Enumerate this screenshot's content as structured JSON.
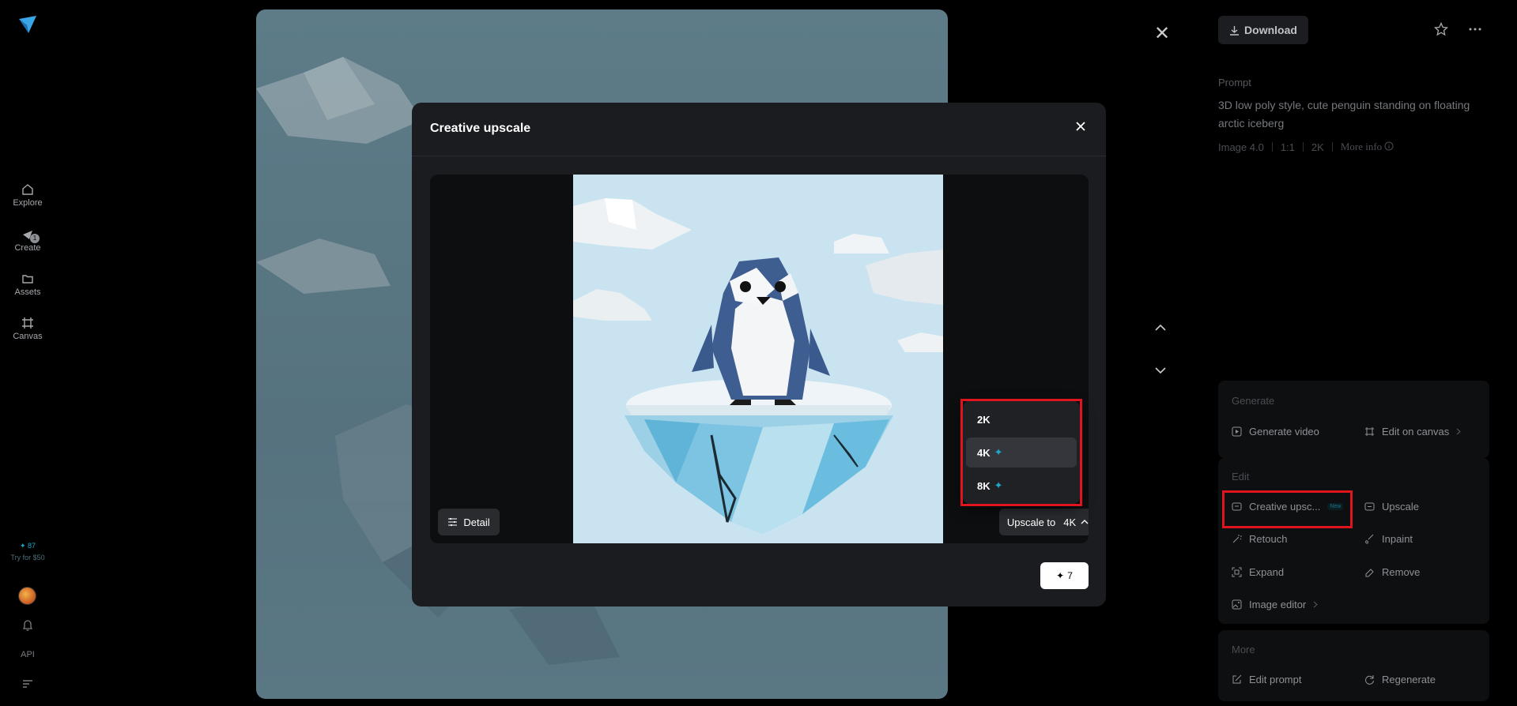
{
  "leftnav": {
    "items": [
      {
        "label": "Explore",
        "icon": "home-icon"
      },
      {
        "label": "Create",
        "icon": "create-icon",
        "badge": "1"
      },
      {
        "label": "Assets",
        "icon": "folder-icon"
      },
      {
        "label": "Canvas",
        "icon": "canvas-icon"
      }
    ],
    "credits": "✦ 87",
    "trial": "Try for $50",
    "api": "API"
  },
  "viewer": {
    "close_symbol": "✕"
  },
  "rpanel": {
    "download_label": "Download",
    "prompt_label": "Prompt",
    "prompt_text": "3D low poly style, cute penguin standing on floating arctic iceberg",
    "meta": {
      "model": "Image 4.0",
      "ratio": "1:1",
      "res": "2K",
      "more": "More info"
    },
    "generate": {
      "title": "Generate",
      "items": [
        {
          "label": "Generate video"
        },
        {
          "label": "Edit on canvas"
        }
      ]
    },
    "edit": {
      "title": "Edit",
      "items": [
        {
          "label": "Creative upsc...",
          "tag": "New"
        },
        {
          "label": "Upscale"
        },
        {
          "label": "Retouch"
        },
        {
          "label": "Inpaint"
        },
        {
          "label": "Expand"
        },
        {
          "label": "Remove"
        },
        {
          "label": "Image editor"
        }
      ]
    },
    "more": {
      "title": "More",
      "items": [
        {
          "label": "Edit prompt"
        },
        {
          "label": "Regenerate"
        }
      ]
    }
  },
  "modal": {
    "title": "Creative upscale",
    "detail_label": "Detail",
    "upscale_prefix": "Upscale to",
    "upscale_value": "4K",
    "submit_cost": "7",
    "dropdown": [
      {
        "label": "2K",
        "premium": false
      },
      {
        "label": "4K",
        "premium": true,
        "selected": true
      },
      {
        "label": "8K",
        "premium": true
      }
    ]
  },
  "colors": {
    "accent": "#1fa8c9",
    "highlight": "#e0141c"
  }
}
